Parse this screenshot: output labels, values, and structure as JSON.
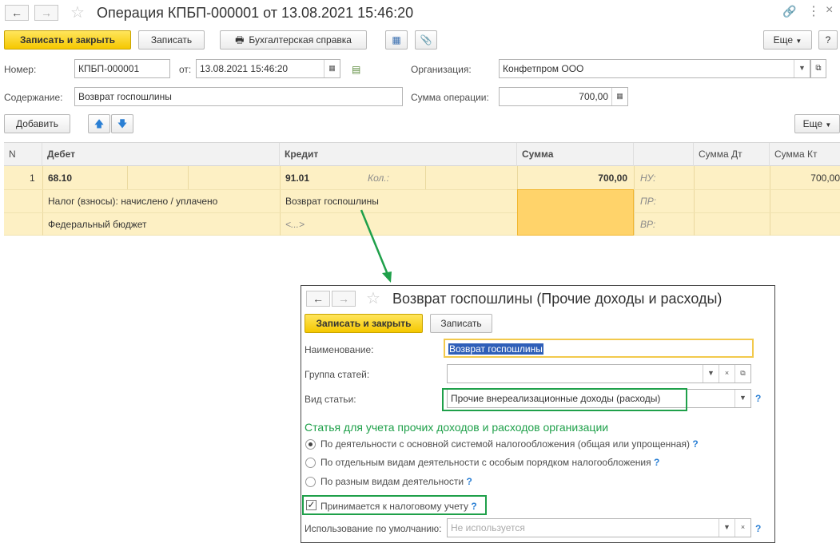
{
  "window": {
    "title": "Операция КПБП-000001 от 13.08.2021 15:46:20",
    "more_label": "Еще",
    "help_label": "?"
  },
  "toolbar": {
    "save_close_label": "Записать и закрыть",
    "save_label": "Записать",
    "report_label": "Бухгалтерская справка"
  },
  "form": {
    "number_label": "Номер:",
    "number_value": "КПБП-000001",
    "date_label": "от:",
    "date_value": "13.08.2021 15:46:20",
    "org_label": "Организация:",
    "org_value": "Конфетпром ООО",
    "content_label": "Содержание:",
    "content_value": "Возврат госпошлины",
    "sum_label": "Сумма операции:",
    "sum_value": "700,00"
  },
  "table_toolbar": {
    "add_label": "Добавить",
    "more_label": "Еще"
  },
  "table": {
    "headers": {
      "n": "N",
      "debit": "Дебет",
      "credit": "Кредит",
      "sum": "Сумма",
      "sum_dt": "Сумма Дт",
      "sum_kt": "Сумма Кт"
    },
    "row": {
      "n": "1",
      "debit_account": "68.10",
      "debit_sub1": "Налог (взносы): начислено / уплачено",
      "debit_sub2": "Федеральный бюджет",
      "credit_account": "91.01",
      "qty_label": "Кол.:",
      "credit_sub1": "Возврат госпошлины",
      "credit_sub2": "<...>",
      "sum": "700,00",
      "nu_label": "НУ:",
      "pr_label": "ПР:",
      "vr_label": "ВР:",
      "sum_kt": "700,00"
    }
  },
  "sub": {
    "title": "Возврат госпошлины (Прочие доходы и расходы)",
    "save_close_label": "Записать и закрыть",
    "save_label": "Записать",
    "name_label": "Наименование:",
    "name_value": "Возврат госпошлины",
    "group_label": "Группа статей:",
    "group_value": "",
    "kind_label": "Вид статьи:",
    "kind_value": "Прочие внереализационные доходы (расходы)",
    "section_title": "Статья для учета прочих доходов и расходов организации",
    "radio1": "По деятельности с основной системой налогообложения (общая или упрощенная)",
    "radio2": "По отдельным видам деятельности с особым порядком налогообложения",
    "radio3": "По разным видам деятельности",
    "tax_checkbox_label": "Принимается к налоговому учету",
    "default_label": "Использование по умолчанию:",
    "default_placeholder": "Не используется",
    "help_mark": "?"
  },
  "colors": {
    "accent_yellow": "#f5c800",
    "row_highlight": "#fdf0c4",
    "green_annotation": "#1fa04a",
    "help_blue": "#2a7fd4"
  }
}
